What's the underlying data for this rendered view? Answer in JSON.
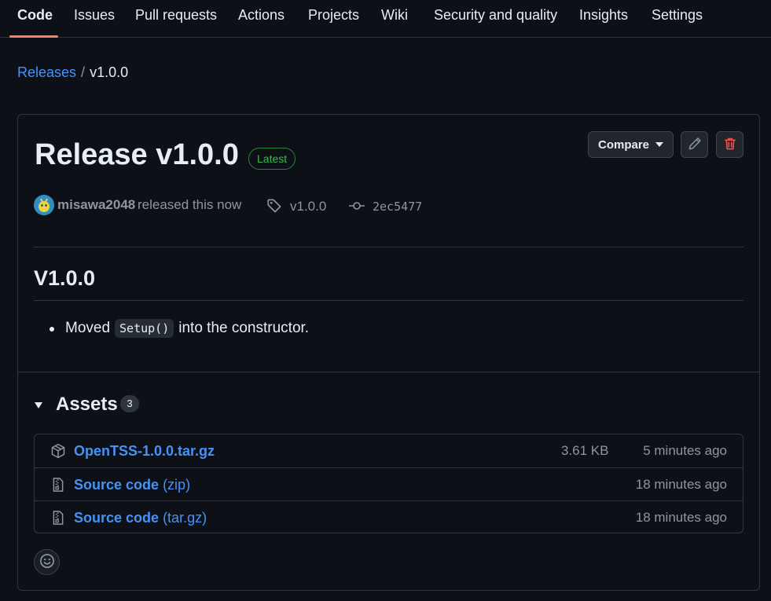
{
  "nav": {
    "tabs": [
      "Code",
      "Issues",
      "Pull requests",
      "Actions",
      "Projects",
      "Wiki",
      "Security and quality",
      "Insights",
      "Settings"
    ]
  },
  "breadcrumb": {
    "parent": "Releases",
    "separator": "/",
    "current": "v1.0.0"
  },
  "release": {
    "title": "Release v1.0.0",
    "badge": "Latest",
    "compare_label": "Compare",
    "author": "misawa2048",
    "released_text": "released this now",
    "tag": "v1.0.0",
    "commit": "2ec5477",
    "body_heading": "V1.0.0",
    "body_item": {
      "before": "Moved",
      "code": "Setup()",
      "after": "into the constructor."
    }
  },
  "assets": {
    "heading": "Assets",
    "count": "3",
    "rows": [
      {
        "name": "OpenTSS-1.0.0.tar.gz",
        "ext": "",
        "size": "3.61 KB",
        "time": "5 minutes ago",
        "icon": "package-icon"
      },
      {
        "name": "Source code",
        "ext": "(zip)",
        "size": "",
        "time": "18 minutes ago",
        "icon": "file-zip-icon"
      },
      {
        "name": "Source code",
        "ext": "(tar.gz)",
        "size": "",
        "time": "18 minutes ago",
        "icon": "file-zip-icon"
      }
    ]
  },
  "colors": {
    "background": "#0d1117",
    "link": "#4493f8",
    "latest_green": "#3fb950",
    "danger_red": "#f85149",
    "tab_underline": "#f78166"
  }
}
